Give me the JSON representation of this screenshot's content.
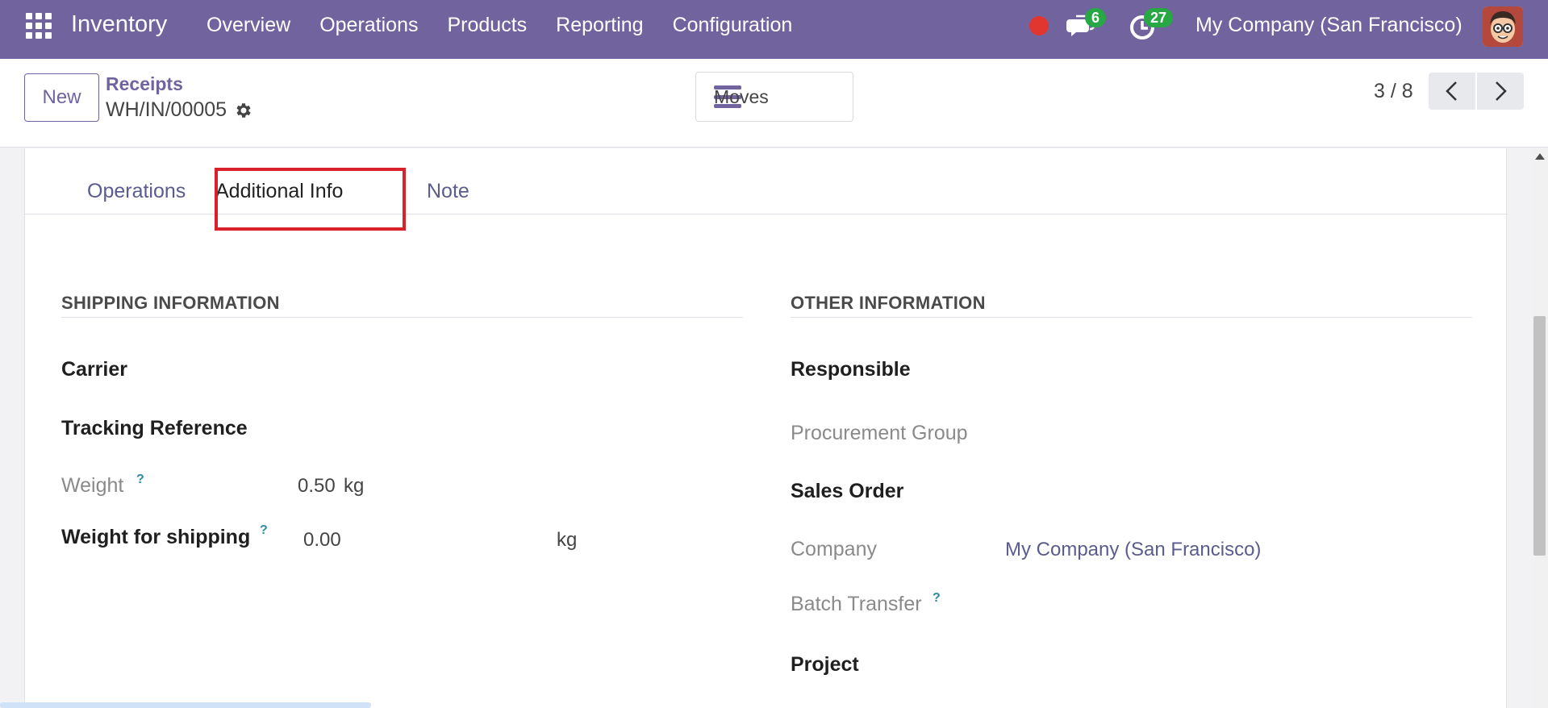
{
  "navbar": {
    "app_name": "Inventory",
    "menu": [
      "Overview",
      "Operations",
      "Products",
      "Reporting",
      "Configuration"
    ],
    "messages_count": "6",
    "activities_count": "27",
    "company": "My Company (San Francisco)",
    "accent_color": "#71639e"
  },
  "control_panel": {
    "new_label": "New",
    "breadcrumb_parent": "Receipts",
    "breadcrumb_current": "WH/IN/00005",
    "moves_label": "Moves",
    "pager": "3 / 8"
  },
  "tabs": [
    {
      "label": "Operations",
      "active": false
    },
    {
      "label": "Additional Info",
      "active": true
    },
    {
      "label": "Note",
      "active": false
    }
  ],
  "shipping": {
    "title": "SHIPPING INFORMATION",
    "carrier_label": "Carrier",
    "tracking_label": "Tracking Reference",
    "weight_label": "Weight",
    "weight_value": "0.50",
    "weight_unit": "kg",
    "weight_shipping_label": "Weight for shipping",
    "weight_shipping_value": "0.00",
    "weight_shipping_unit": "kg",
    "help_mark": "?"
  },
  "other": {
    "title": "OTHER INFORMATION",
    "responsible_label": "Responsible",
    "procurement_label": "Procurement Group",
    "sales_order_label": "Sales Order",
    "company_label": "Company",
    "company_value": "My Company (San Francisco)",
    "batch_label": "Batch Transfer",
    "project_label": "Project",
    "help_mark": "?"
  }
}
